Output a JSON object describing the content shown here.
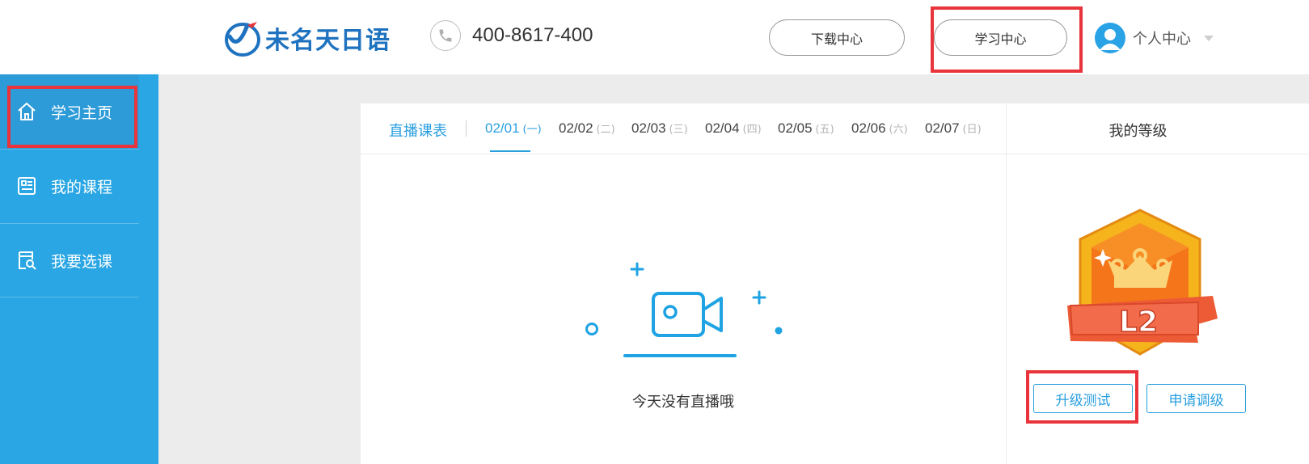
{
  "header": {
    "logo_text": "未名天日语",
    "phone": "400-8617-400",
    "download_label": "下载中心",
    "study_label": "学习中心",
    "user_label": "个人中心"
  },
  "sidebar": {
    "items": [
      {
        "label": "学习主页",
        "icon": "home-icon"
      },
      {
        "label": "我的课程",
        "icon": "course-list-icon"
      },
      {
        "label": "我要选课",
        "icon": "course-search-icon"
      }
    ]
  },
  "schedule": {
    "title": "直播课表",
    "days": [
      {
        "date": "02/01",
        "weekday": "(一)"
      },
      {
        "date": "02/02",
        "weekday": "(二)"
      },
      {
        "date": "02/03",
        "weekday": "(三)"
      },
      {
        "date": "02/04",
        "weekday": "(四)"
      },
      {
        "date": "02/05",
        "weekday": "(五)"
      },
      {
        "date": "02/06",
        "weekday": "(六)"
      },
      {
        "date": "02/07",
        "weekday": "(日)"
      }
    ],
    "empty_text": "今天没有直播哦"
  },
  "level": {
    "title": "我的等级",
    "badge_text": "L2",
    "upgrade_label": "升级测试",
    "adjust_label": "申请调级"
  },
  "colors": {
    "accent": "#2a9fe0",
    "sidebar": "#29a6e3",
    "highlight": "#e8343a"
  }
}
